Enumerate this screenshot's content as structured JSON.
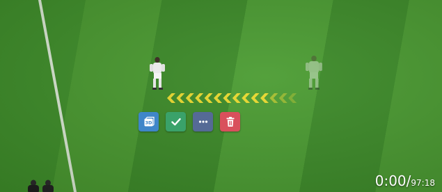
{
  "video": {
    "current_time": "0:00",
    "separator": "/",
    "total_time": "97:18"
  },
  "toolbar": {
    "view3d_icon_label": "3D",
    "buttons": [
      {
        "name": "3d-view-button",
        "icon": "3d-cube-icon",
        "color": "#3f86c9"
      },
      {
        "name": "confirm-button",
        "icon": "check-icon",
        "color": "#3aa26a"
      },
      {
        "name": "more-options-button",
        "icon": "ellipsis-icon",
        "color": "#556a96"
      },
      {
        "name": "delete-button",
        "icon": "trash-icon",
        "color": "#d9505c"
      }
    ]
  },
  "annotation": {
    "type": "chevron-arrow",
    "direction": "left",
    "color": "#f2dd2e",
    "chevron_count": 14
  },
  "colors": {
    "pitch_dark": "#3c8a28",
    "pitch_light": "#4b9c32",
    "kit": "#ffffff"
  }
}
